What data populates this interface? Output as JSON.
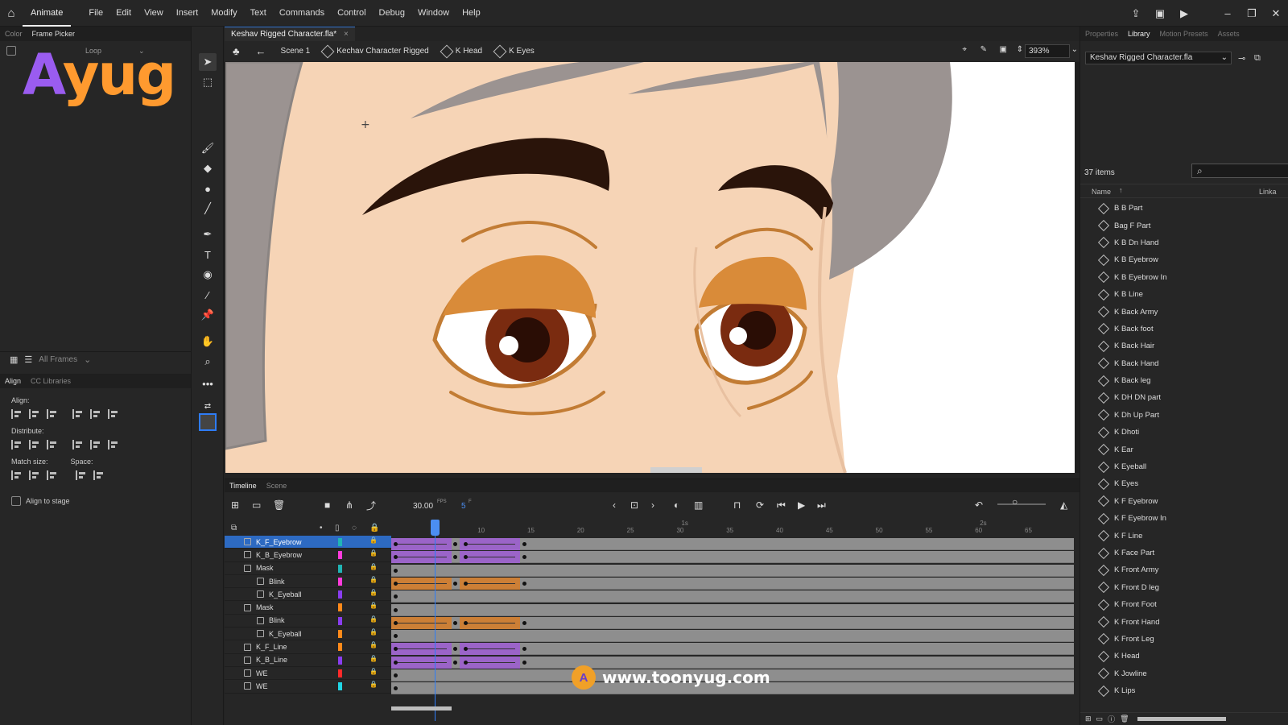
{
  "menubar": {
    "app_name": "Animate",
    "items": [
      "File",
      "Edit",
      "View",
      "Insert",
      "Modify",
      "Text",
      "Commands",
      "Control",
      "Debug",
      "Window",
      "Help"
    ]
  },
  "left_panel": {
    "tabs": [
      "Color",
      "Frame Picker"
    ],
    "loop_label": "Loop",
    "all_frames": "All Frames",
    "align_tabs": [
      "Align",
      "CC Libraries"
    ],
    "align_label": "Align:",
    "distribute_label": "Distribute:",
    "match_size_label": "Match size:",
    "space_label": "Space:",
    "align_to_stage": "Align to stage"
  },
  "document": {
    "tab_title": "Keshav Rigged Character.fla*",
    "breadcrumbs": [
      "Scene 1",
      "Kechav Character Rigged",
      "K Head",
      "K Eyes"
    ],
    "zoom": "393%"
  },
  "timeline": {
    "tabs": [
      "Timeline",
      "Scene"
    ],
    "fps": "30.00",
    "fps_unit": "FPS",
    "current_frame": "5",
    "frame_unit": "F",
    "ruler_numbers": [
      "10",
      "15",
      "20",
      "25",
      "30",
      "35",
      "40",
      "45",
      "50",
      "55",
      "60",
      "65"
    ],
    "time_marks": [
      "1s",
      "2s"
    ],
    "layers": [
      {
        "name": "K_F_Eyebrow",
        "color": "#20b5b5",
        "indent": 0,
        "selected": true
      },
      {
        "name": "K_B_Eyebrow",
        "color": "#ff3bdc",
        "indent": 0
      },
      {
        "name": "Mask",
        "color": "#20b5b5",
        "indent": 0
      },
      {
        "name": "Blink",
        "color": "#ff3bdc",
        "indent": 1
      },
      {
        "name": "K_Eyeball",
        "color": "#8a3df0",
        "indent": 1
      },
      {
        "name": "Mask",
        "color": "#ff8a1a",
        "indent": 0
      },
      {
        "name": "Blink",
        "color": "#8a3df0",
        "indent": 1
      },
      {
        "name": "K_Eyeball",
        "color": "#ff8a1a",
        "indent": 1
      },
      {
        "name": "K_F_Line",
        "color": "#ff8a1a",
        "indent": 0
      },
      {
        "name": "K_B_Line",
        "color": "#8a3df0",
        "indent": 0
      },
      {
        "name": "WE",
        "color": "#ff2a2a",
        "indent": 0
      },
      {
        "name": "WE",
        "color": "#20d5e5",
        "indent": 0
      }
    ]
  },
  "right_panel": {
    "tabs": [
      "Properties",
      "Library",
      "Motion Presets",
      "Assets"
    ],
    "library_file": "Keshav Rigged Character.fla",
    "item_count": "37 items",
    "column_name": "Name",
    "column_linkage": "Linka",
    "items": [
      "B B Part",
      "Bag F Part",
      "K B Dn Hand",
      "K B Eyebrow",
      "K B Eyebrow In",
      "K B Line",
      "K Back Army",
      "K Back foot",
      "K Back Hair",
      "K Back Hand",
      "K Back leg",
      "K DH DN part",
      "K Dh Up Part",
      "K Dhoti",
      "K Ear",
      "K Eyeball",
      "K Eyes",
      "K F Eyebrow",
      "K F Eyebrow In",
      "K F Line",
      "K Face Part",
      "K Front Army",
      "K Front D leg",
      "K Front Foot",
      "K Front Hand",
      "K Front Leg",
      "K Head",
      "K Jowline",
      "K Lips"
    ]
  },
  "watermark": {
    "logo_a": "A",
    "logo_text": "yug",
    "footer_url": "www.toonyug.com"
  }
}
